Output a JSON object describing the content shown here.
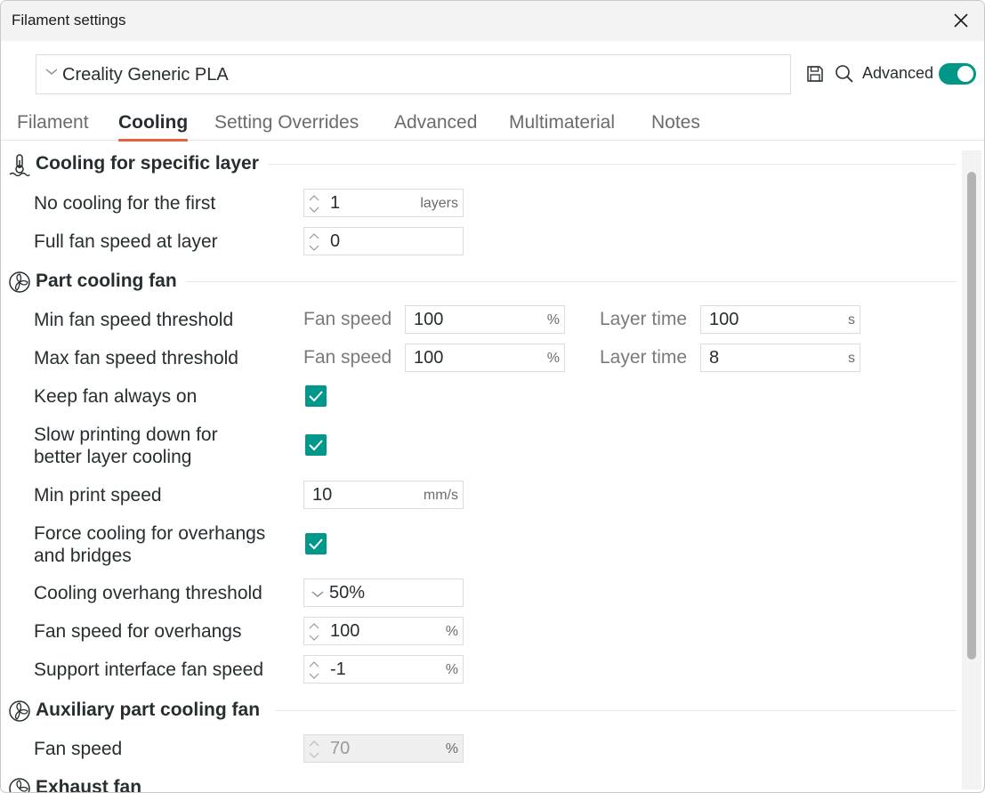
{
  "window": {
    "title": "Filament settings"
  },
  "preset": {
    "name": "Creality Generic PLA"
  },
  "toolbar": {
    "advanced_label": "Advanced",
    "advanced_on": true
  },
  "tabs": [
    {
      "label": "Filament"
    },
    {
      "label": "Cooling",
      "active": true
    },
    {
      "label": "Setting Overrides"
    },
    {
      "label": "Advanced"
    },
    {
      "label": "Multimaterial"
    },
    {
      "label": "Notes"
    }
  ],
  "sections": {
    "specific_layer": "Cooling for specific layer",
    "part_fan": "Part cooling fan",
    "aux_fan": "Auxiliary part cooling fan",
    "exhaust_fan": "Exhaust fan"
  },
  "settings": {
    "no_cooling_first": {
      "label": "No cooling for the first",
      "value": "1",
      "unit": "layers"
    },
    "full_fan_at_layer": {
      "label": "Full fan speed at layer",
      "value": "0"
    },
    "min_fan_threshold": {
      "label": "Min fan speed threshold",
      "fan_label": "Fan speed",
      "fan_value": "100",
      "fan_unit": "%",
      "time_label": "Layer time",
      "time_value": "100",
      "time_unit": "s"
    },
    "max_fan_threshold": {
      "label": "Max fan speed threshold",
      "fan_label": "Fan speed",
      "fan_value": "100",
      "fan_unit": "%",
      "time_label": "Layer time",
      "time_value": "8",
      "time_unit": "s"
    },
    "keep_fan_on": {
      "label": "Keep fan always on",
      "checked": true
    },
    "slow_down": {
      "label_line1": "Slow printing down for",
      "label_line2": "better layer cooling",
      "checked": true
    },
    "min_print_speed": {
      "label": "Min print speed",
      "value": "10",
      "unit": "mm/s"
    },
    "force_cooling": {
      "label_line1": "Force cooling for overhangs",
      "label_line2": "and bridges",
      "checked": true
    },
    "overhang_threshold": {
      "label": "Cooling overhang threshold",
      "value": "50%"
    },
    "overhang_fan_speed": {
      "label": "Fan speed for overhangs",
      "value": "100",
      "unit": "%"
    },
    "support_fan_speed": {
      "label": "Support interface fan speed",
      "value": "-1",
      "unit": "%"
    },
    "aux_fan_speed": {
      "label": "Fan speed",
      "value": "70",
      "unit": "%",
      "disabled": true
    }
  },
  "colors": {
    "accent": "#009688",
    "tab_underline": "#e8603c"
  }
}
